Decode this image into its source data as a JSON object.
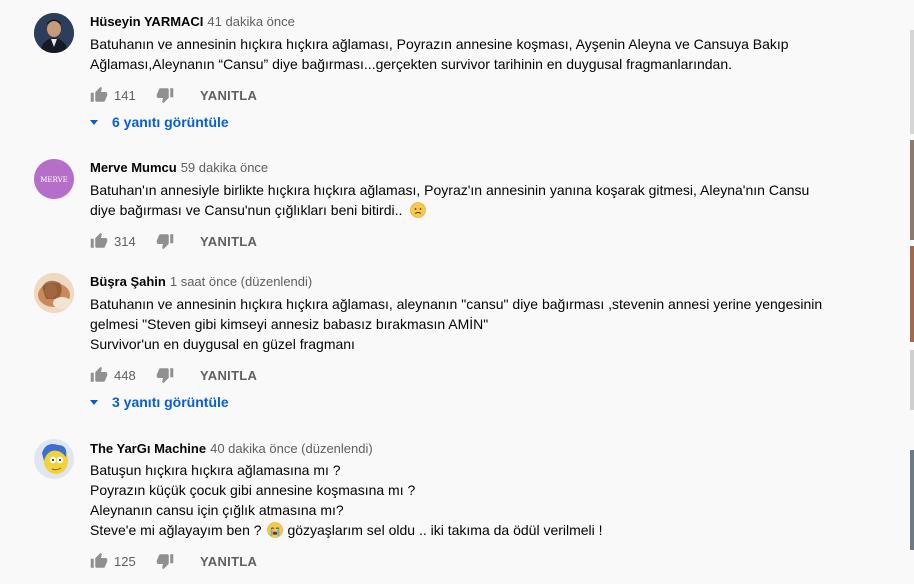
{
  "reply_label": "YANITLA",
  "comments": [
    {
      "author": "Hüseyin YARMACI",
      "time": "41 dakika önce",
      "lines": [
        "Batuhanın ve annesinin hıçkıra hıçkıra ağlaması, Poyrazın annesine koşması, Ayşenin Aleyna ve Cansuya Bakıp",
        "Ağlaması,Aleynanın “Cansu” diye bağırması...gerçekten survivor tarihinin en duygusal fragmanlarından."
      ],
      "likes": "141",
      "replies": "6 yanıtı görüntüle"
    },
    {
      "author": "Merve Mumcu",
      "time": "59 dakika önce",
      "avatar_text": "MERVE",
      "lines": [
        "Batuhan'ın annesiyle birlikte hıçkıra hıçkıra ağlaması, Poyraz'ın annesinin yanına koşarak gitmesi, Aleyna'nın Cansu",
        "diye bağırması ve Cansu'nun çığlıkları beni bitirdi.."
      ],
      "likes": "314"
    },
    {
      "author": "Büşra Şahin",
      "time": "1 saat önce (düzenlendi)",
      "lines": [
        "Batuhanın ve annesinin hıçkıra hıçkıra ağlaması, aleynanın \"cansu\" diye bağırması ,stevenin  annesi yerine yengesinin",
        "gelmesi \"Steven gibi kimseyi annesiz babasız bırakmasın AMİN\"",
        "Survivor'un en duygusal en güzel fragmanı"
      ],
      "likes": "448",
      "replies": "3 yanıtı görüntüle"
    },
    {
      "author": "The YarGı Machine",
      "time": "40 dakika önce (düzenlendi)",
      "lines": [
        "Batuşun hıçkıra hıçkıra ağlamasına mı ?",
        "Poyrazın küçük çocuk gibi annesine koşmasına mı ?",
        "Aleynanın cansu için çığlık atmasına mı?",
        "Steve'e mi ağlayayım ben ?",
        "gözyaşlarım sel oldu .. iki takıma da ödül verilmeli !"
      ],
      "likes": "125"
    }
  ]
}
